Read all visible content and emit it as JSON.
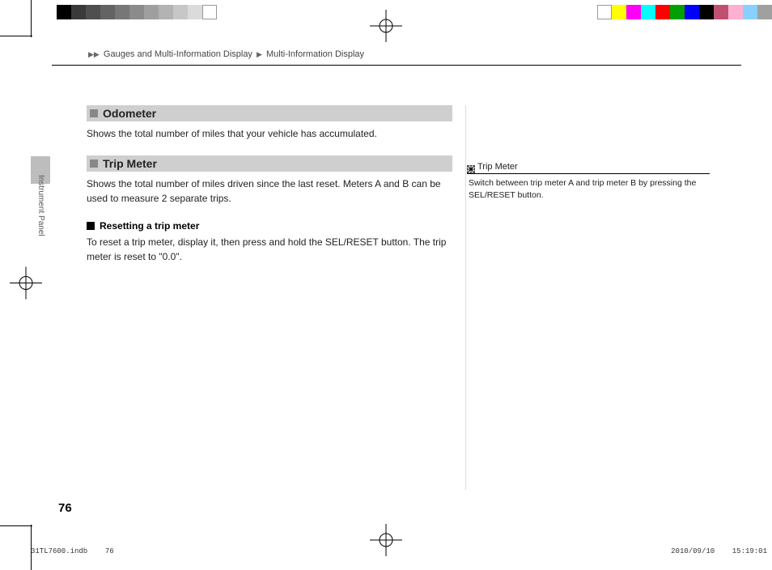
{
  "breadcrumb": {
    "level1": "Gauges and Multi-Information Display",
    "level2": "Multi-Information Display"
  },
  "side_tab": "Instrument Panel",
  "sections": {
    "odometer": {
      "title": "Odometer",
      "body": "Shows the total number of miles that your vehicle has accumulated."
    },
    "trip_meter": {
      "title": "Trip Meter",
      "body": "Shows the total number of miles driven since the last reset. Meters A and B can be used to measure 2 separate trips.",
      "sub_title": "Resetting a trip meter",
      "sub_body": "To reset a trip meter, display it, then press and hold the SEL/RESET button. The trip meter is reset to \"0.0\"."
    }
  },
  "sidebar": {
    "ref_title": "Trip Meter",
    "ref_body": "Switch between trip meter A and trip meter B by pressing the SEL/RESET button."
  },
  "page_number": "76",
  "imprint": {
    "file": "31TL7600.indb",
    "file_page": "76",
    "date": "2010/09/10",
    "time": "15:19:01"
  },
  "colorbar_left": [
    "#000000",
    "#3a3a3a",
    "#4f4f4f",
    "#636363",
    "#777777",
    "#8b8b8b",
    "#9f9f9f",
    "#b3b3b3",
    "#c7c7c7",
    "#dbdbdb",
    "#ffffff"
  ],
  "colorbar_right": [
    "#ffffff",
    "#ffff00",
    "#ff00ff",
    "#00ffff",
    "#ff0000",
    "#00a000",
    "#0000ff",
    "#000000",
    "#c05070",
    "#ffb0d0",
    "#88d0ff",
    "#a0a0a0"
  ]
}
